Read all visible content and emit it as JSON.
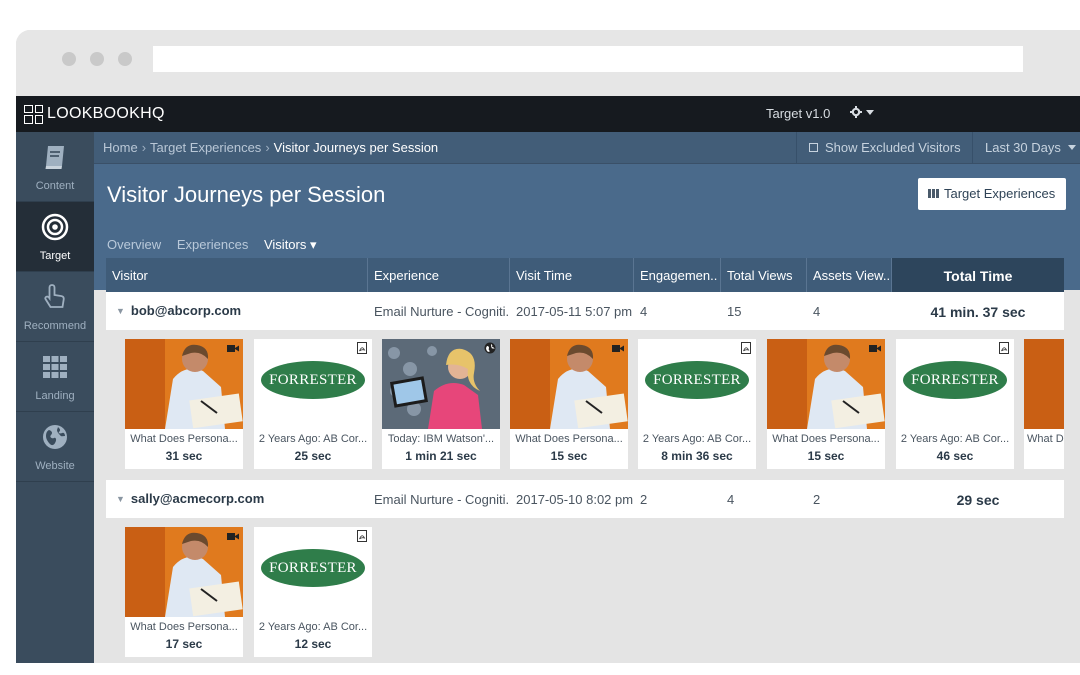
{
  "app": {
    "logo": "LOOKBOOKHQ",
    "product": "Target v1.0",
    "settings_icon": "gear-icon"
  },
  "sidebar": {
    "items": [
      {
        "label": "Content",
        "icon": "book-icon",
        "active": false
      },
      {
        "label": "Target",
        "icon": "target-icon",
        "active": true
      },
      {
        "label": "Recommend",
        "icon": "hand-pointer-icon",
        "active": false
      },
      {
        "label": "Landing",
        "icon": "grid-icon",
        "active": false
      },
      {
        "label": "Website",
        "icon": "globe-icon",
        "active": false
      }
    ]
  },
  "breadcrumb": {
    "home": "Home",
    "section": "Target Experiences",
    "current": "Visitor Journeys per Session",
    "separator": "›"
  },
  "toolbar": {
    "excluded_label": "Show Excluded Visitors",
    "date_range": "Last 30 Days"
  },
  "page": {
    "title": "Visitor Journeys per Session",
    "target_button": "Target Experiences"
  },
  "subnav": {
    "overview": "Overview",
    "experiences": "Experiences",
    "visitors": "Visitors ▾"
  },
  "table": {
    "columns": [
      "Visitor",
      "Experience",
      "Visit Time",
      "Engagemen..",
      "Total Views",
      "Assets View..",
      "Total Time"
    ],
    "rows": [
      {
        "visitor": "bob@abcorp.com",
        "experience": "Email Nurture - Cogniti...",
        "visit_time": "2017-05-11 5:07 pm",
        "engagement": "4",
        "total_views": "15",
        "assets_viewed": "4",
        "total_time": "41 min. 37 sec",
        "assets": [
          {
            "type": "video",
            "title": "What Does Persona...",
            "time": "31 sec"
          },
          {
            "type": "pdf",
            "title": "2 Years Ago: AB Cor...",
            "time": "25 sec"
          },
          {
            "type": "web",
            "title": "Today: IBM Watson'...",
            "time": "1 min 21 sec"
          },
          {
            "type": "video",
            "title": "What Does Persona...",
            "time": "15 sec"
          },
          {
            "type": "pdf",
            "title": "2 Years Ago: AB Cor...",
            "time": "8 min 36 sec"
          },
          {
            "type": "video",
            "title": "What Does Persona...",
            "time": "15 sec"
          },
          {
            "type": "pdf",
            "title": "2 Years Ago: AB Cor...",
            "time": "46 sec"
          },
          {
            "type": "video",
            "title": "What D",
            "time": ""
          }
        ]
      },
      {
        "visitor": "sally@acmecorp.com",
        "experience": "Email Nurture - Cogniti...",
        "visit_time": "2017-05-10 8:02 pm",
        "engagement": "2",
        "total_views": "4",
        "assets_viewed": "2",
        "total_time": "29 sec",
        "assets": [
          {
            "type": "video",
            "title": "What Does Persona...",
            "time": "17 sec"
          },
          {
            "type": "pdf",
            "title": "2 Years Ago: AB Cor...",
            "time": "12 sec"
          }
        ]
      }
    ]
  },
  "forrester_logo": "FORRESTER"
}
